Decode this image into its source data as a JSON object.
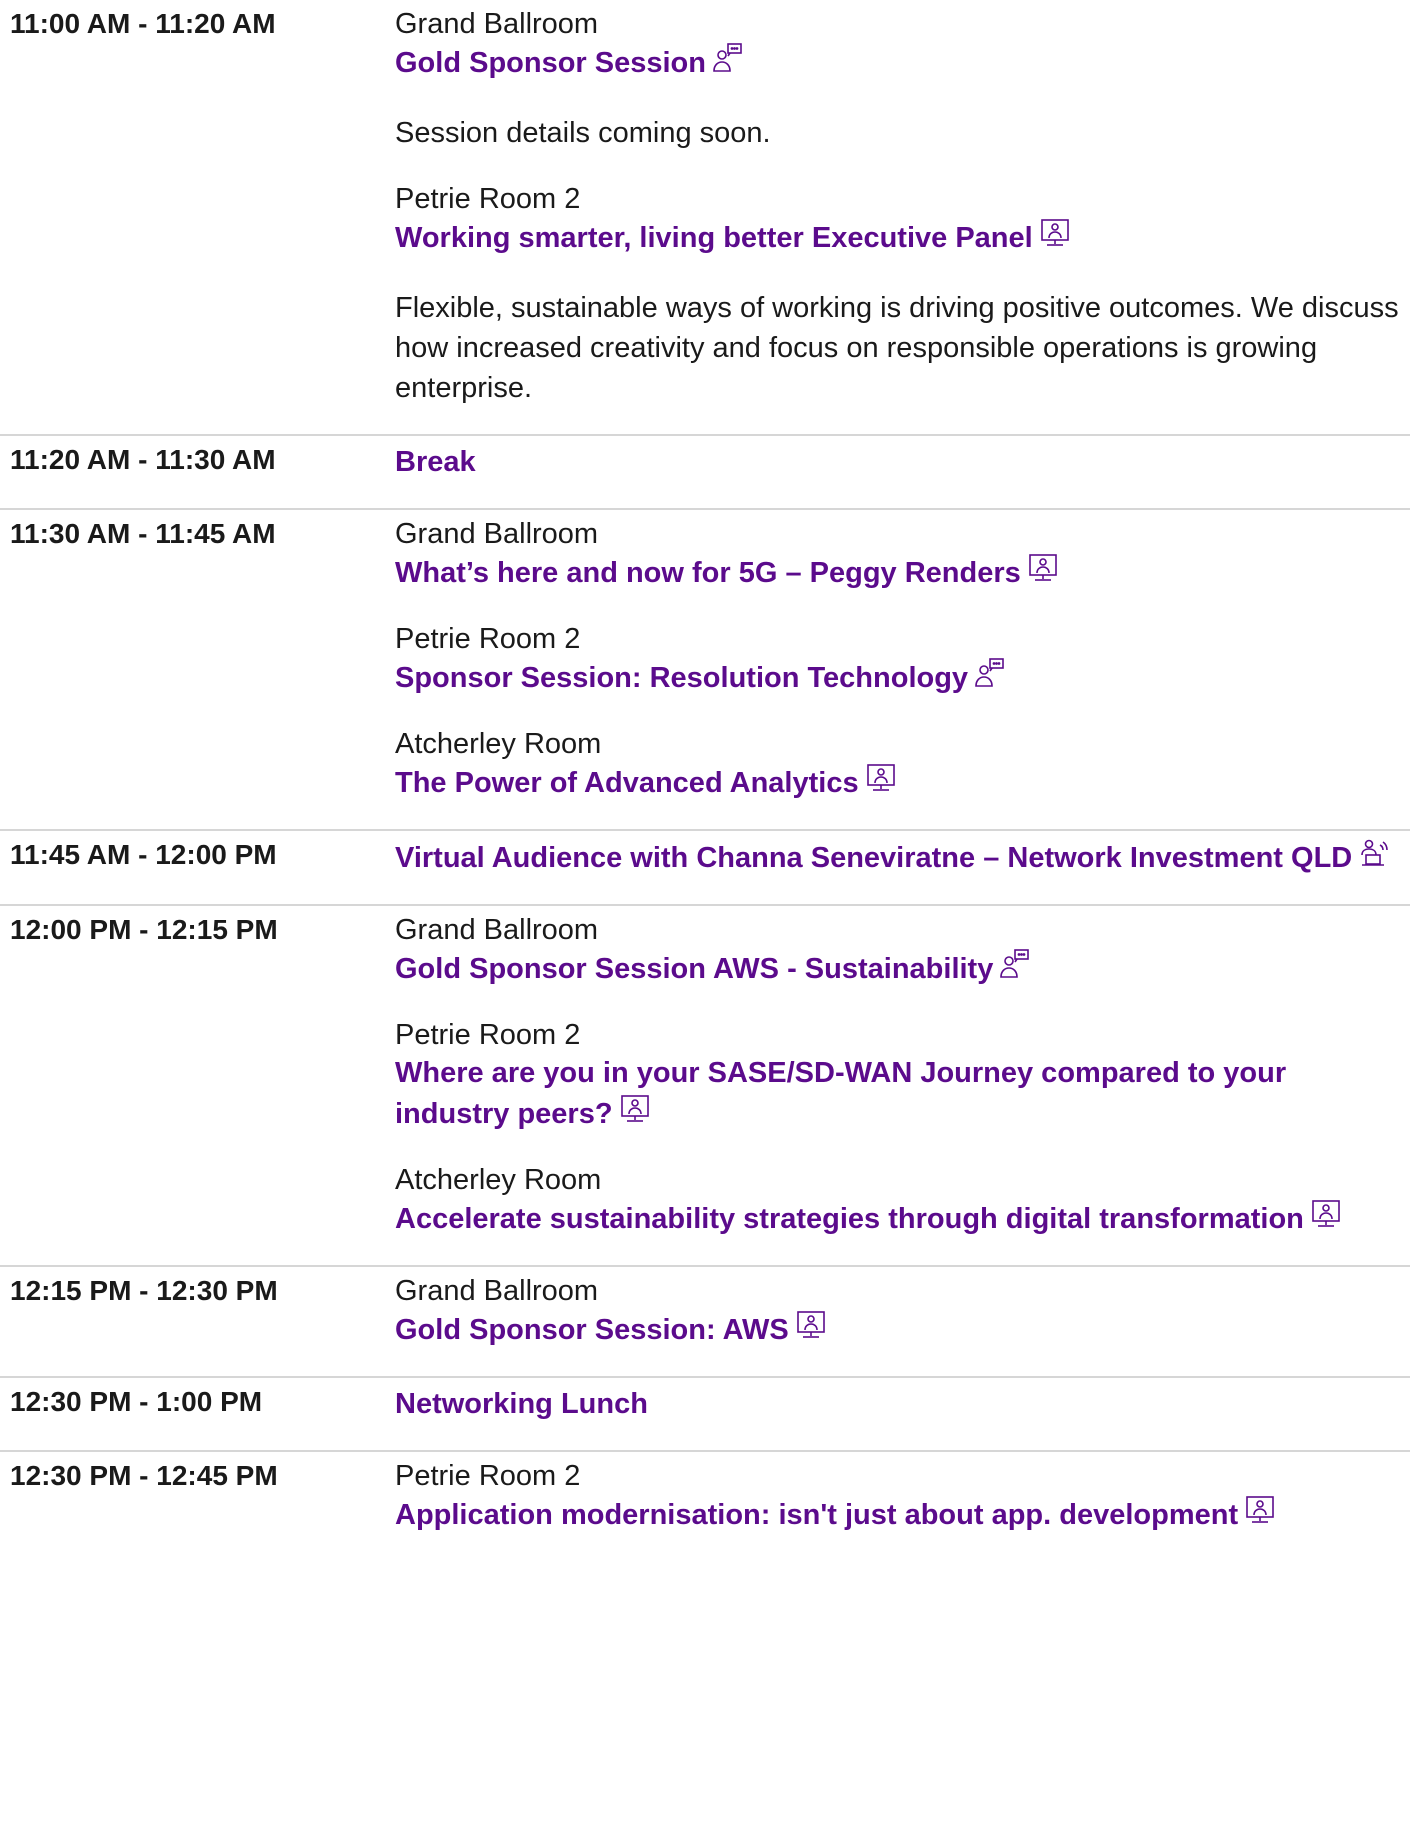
{
  "agenda": [
    {
      "time": "11:00 AM - 11:20 AM",
      "sessions": [
        {
          "room": "Grand Ballroom",
          "title": "Gold Sponsor Session",
          "icon": "sponsor-speech-icon",
          "desc": "Session details coming soon."
        },
        {
          "room": "Petrie Room 2",
          "title": "Working smarter, living better Executive Panel",
          "icon": "presentation-icon",
          "desc": "Flexible, sustainable ways of working is driving positive outcomes. We discuss how increased creativity and focus on responsible operations is growing enterprise."
        }
      ]
    },
    {
      "time": "11:20 AM - 11:30 AM",
      "sessions": [
        {
          "room": "",
          "title": "Break",
          "icon": "",
          "desc": ""
        }
      ]
    },
    {
      "time": "11:30 AM - 11:45 AM",
      "sessions": [
        {
          "room": "Grand Ballroom",
          "title": "What’s here and now for 5G – Peggy Renders",
          "icon": "presentation-icon",
          "desc": ""
        },
        {
          "room": "Petrie Room 2",
          "title": "Sponsor Session: Resolution Technology",
          "icon": "sponsor-speech-icon",
          "desc": ""
        },
        {
          "room": "Atcherley Room",
          "title": "The Power of Advanced Analytics",
          "icon": "presentation-icon",
          "desc": ""
        }
      ]
    },
    {
      "time": "11:45 AM - 12:00 PM",
      "sessions": [
        {
          "room": "",
          "title": "Virtual Audience with Channa Seneviratne – Network Investment QLD",
          "icon": "virtual-audience-icon",
          "desc": ""
        }
      ]
    },
    {
      "time": "12:00 PM - 12:15 PM",
      "sessions": [
        {
          "room": "Grand Ballroom",
          "title": "Gold Sponsor Session AWS - Sustainability",
          "icon": "sponsor-speech-icon",
          "desc": ""
        },
        {
          "room": "Petrie Room 2",
          "title": "Where are you in your SASE/SD-WAN Journey compared to your industry peers?",
          "icon": "presentation-icon",
          "desc": ""
        },
        {
          "room": "Atcherley Room",
          "title": "Accelerate sustainability strategies through digital transformation",
          "icon": "presentation-icon",
          "desc": ""
        }
      ]
    },
    {
      "time": "12:15 PM - 12:30 PM",
      "sessions": [
        {
          "room": "Grand Ballroom",
          "title": "Gold Sponsor Session: AWS",
          "icon": "presentation-icon",
          "desc": ""
        }
      ]
    },
    {
      "time": "12:30 PM - 1:00 PM",
      "sessions": [
        {
          "room": "",
          "title": "Networking Lunch",
          "icon": "",
          "desc": ""
        }
      ]
    },
    {
      "time": "12:30 PM - 12:45 PM",
      "sessions": [
        {
          "room": "Petrie Room 2",
          "title": "Application modernisation: isn't just about app. development",
          "icon": "presentation-icon",
          "desc": ""
        }
      ]
    }
  ],
  "colors": {
    "title": "#5b0b8c",
    "text": "#1a1a1a",
    "divider": "#d6d6d6"
  }
}
